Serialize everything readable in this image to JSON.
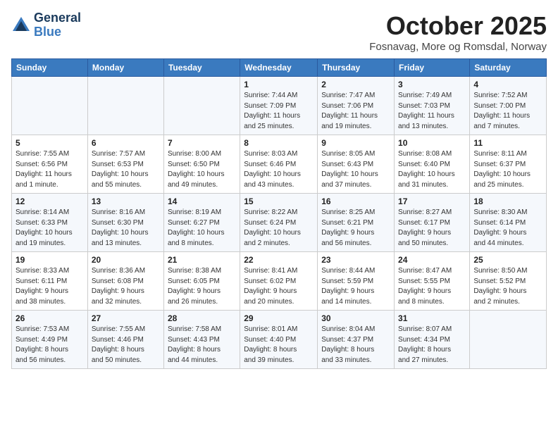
{
  "header": {
    "logo_line1": "General",
    "logo_line2": "Blue",
    "month": "October 2025",
    "location": "Fosnavag, More og Romsdal, Norway"
  },
  "weekdays": [
    "Sunday",
    "Monday",
    "Tuesday",
    "Wednesday",
    "Thursday",
    "Friday",
    "Saturday"
  ],
  "weeks": [
    [
      {
        "day": "",
        "detail": ""
      },
      {
        "day": "",
        "detail": ""
      },
      {
        "day": "",
        "detail": ""
      },
      {
        "day": "1",
        "detail": "Sunrise: 7:44 AM\nSunset: 7:09 PM\nDaylight: 11 hours\nand 25 minutes."
      },
      {
        "day": "2",
        "detail": "Sunrise: 7:47 AM\nSunset: 7:06 PM\nDaylight: 11 hours\nand 19 minutes."
      },
      {
        "day": "3",
        "detail": "Sunrise: 7:49 AM\nSunset: 7:03 PM\nDaylight: 11 hours\nand 13 minutes."
      },
      {
        "day": "4",
        "detail": "Sunrise: 7:52 AM\nSunset: 7:00 PM\nDaylight: 11 hours\nand 7 minutes."
      }
    ],
    [
      {
        "day": "5",
        "detail": "Sunrise: 7:55 AM\nSunset: 6:56 PM\nDaylight: 11 hours\nand 1 minute."
      },
      {
        "day": "6",
        "detail": "Sunrise: 7:57 AM\nSunset: 6:53 PM\nDaylight: 10 hours\nand 55 minutes."
      },
      {
        "day": "7",
        "detail": "Sunrise: 8:00 AM\nSunset: 6:50 PM\nDaylight: 10 hours\nand 49 minutes."
      },
      {
        "day": "8",
        "detail": "Sunrise: 8:03 AM\nSunset: 6:46 PM\nDaylight: 10 hours\nand 43 minutes."
      },
      {
        "day": "9",
        "detail": "Sunrise: 8:05 AM\nSunset: 6:43 PM\nDaylight: 10 hours\nand 37 minutes."
      },
      {
        "day": "10",
        "detail": "Sunrise: 8:08 AM\nSunset: 6:40 PM\nDaylight: 10 hours\nand 31 minutes."
      },
      {
        "day": "11",
        "detail": "Sunrise: 8:11 AM\nSunset: 6:37 PM\nDaylight: 10 hours\nand 25 minutes."
      }
    ],
    [
      {
        "day": "12",
        "detail": "Sunrise: 8:14 AM\nSunset: 6:33 PM\nDaylight: 10 hours\nand 19 minutes."
      },
      {
        "day": "13",
        "detail": "Sunrise: 8:16 AM\nSunset: 6:30 PM\nDaylight: 10 hours\nand 13 minutes."
      },
      {
        "day": "14",
        "detail": "Sunrise: 8:19 AM\nSunset: 6:27 PM\nDaylight: 10 hours\nand 8 minutes."
      },
      {
        "day": "15",
        "detail": "Sunrise: 8:22 AM\nSunset: 6:24 PM\nDaylight: 10 hours\nand 2 minutes."
      },
      {
        "day": "16",
        "detail": "Sunrise: 8:25 AM\nSunset: 6:21 PM\nDaylight: 9 hours\nand 56 minutes."
      },
      {
        "day": "17",
        "detail": "Sunrise: 8:27 AM\nSunset: 6:17 PM\nDaylight: 9 hours\nand 50 minutes."
      },
      {
        "day": "18",
        "detail": "Sunrise: 8:30 AM\nSunset: 6:14 PM\nDaylight: 9 hours\nand 44 minutes."
      }
    ],
    [
      {
        "day": "19",
        "detail": "Sunrise: 8:33 AM\nSunset: 6:11 PM\nDaylight: 9 hours\nand 38 minutes."
      },
      {
        "day": "20",
        "detail": "Sunrise: 8:36 AM\nSunset: 6:08 PM\nDaylight: 9 hours\nand 32 minutes."
      },
      {
        "day": "21",
        "detail": "Sunrise: 8:38 AM\nSunset: 6:05 PM\nDaylight: 9 hours\nand 26 minutes."
      },
      {
        "day": "22",
        "detail": "Sunrise: 8:41 AM\nSunset: 6:02 PM\nDaylight: 9 hours\nand 20 minutes."
      },
      {
        "day": "23",
        "detail": "Sunrise: 8:44 AM\nSunset: 5:59 PM\nDaylight: 9 hours\nand 14 minutes."
      },
      {
        "day": "24",
        "detail": "Sunrise: 8:47 AM\nSunset: 5:55 PM\nDaylight: 9 hours\nand 8 minutes."
      },
      {
        "day": "25",
        "detail": "Sunrise: 8:50 AM\nSunset: 5:52 PM\nDaylight: 9 hours\nand 2 minutes."
      }
    ],
    [
      {
        "day": "26",
        "detail": "Sunrise: 7:53 AM\nSunset: 4:49 PM\nDaylight: 8 hours\nand 56 minutes."
      },
      {
        "day": "27",
        "detail": "Sunrise: 7:55 AM\nSunset: 4:46 PM\nDaylight: 8 hours\nand 50 minutes."
      },
      {
        "day": "28",
        "detail": "Sunrise: 7:58 AM\nSunset: 4:43 PM\nDaylight: 8 hours\nand 44 minutes."
      },
      {
        "day": "29",
        "detail": "Sunrise: 8:01 AM\nSunset: 4:40 PM\nDaylight: 8 hours\nand 39 minutes."
      },
      {
        "day": "30",
        "detail": "Sunrise: 8:04 AM\nSunset: 4:37 PM\nDaylight: 8 hours\nand 33 minutes."
      },
      {
        "day": "31",
        "detail": "Sunrise: 8:07 AM\nSunset: 4:34 PM\nDaylight: 8 hours\nand 27 minutes."
      },
      {
        "day": "",
        "detail": ""
      }
    ]
  ]
}
